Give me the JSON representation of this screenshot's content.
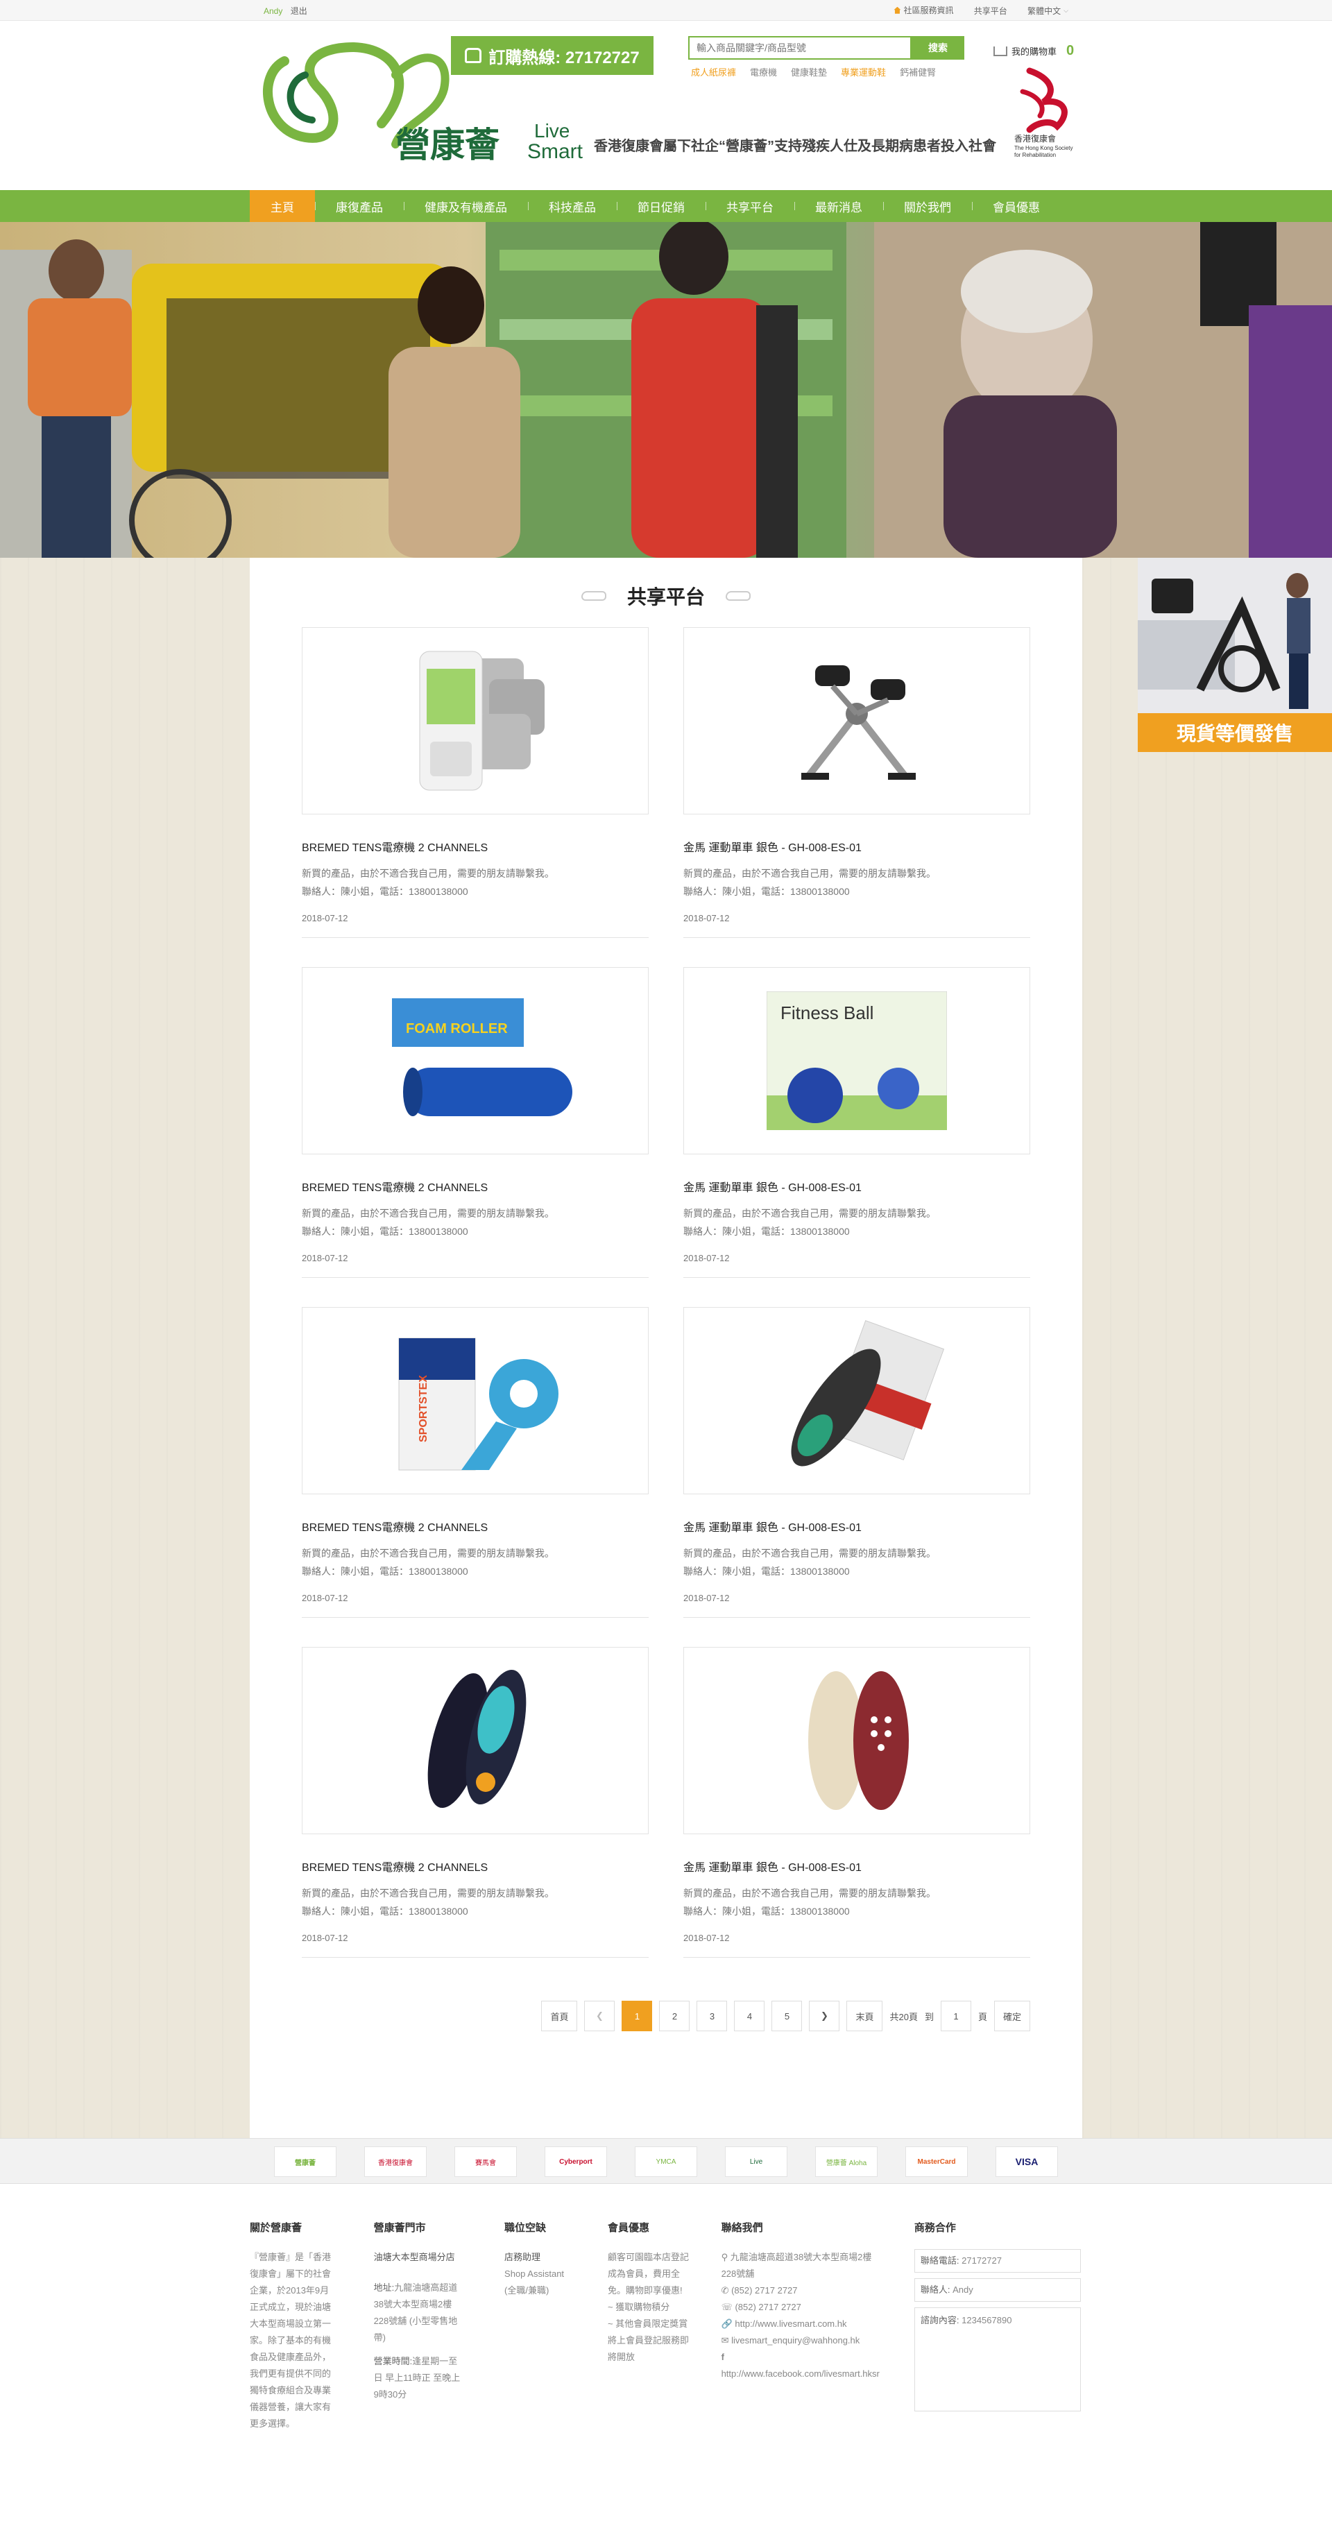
{
  "topbar": {
    "user": "Andy",
    "logout": "退出",
    "links": [
      "社區服務資訊",
      "共享平台",
      "繁體中文"
    ]
  },
  "header": {
    "hotline": "訂購熱線: 27172727",
    "search_placeholder": "輸入商品關鍵字/商品型號",
    "search_button": "搜索",
    "hotwords": [
      "成人紙尿褲",
      "電療機",
      "健康鞋墊",
      "專業運動鞋",
      "鈣補健腎"
    ],
    "slogan": "香港復康會屬下社企“營康薈”支持殘疾人仕及長期病患者投入社會",
    "cart_label": "我的購物車",
    "cart_count": "0",
    "logo_text": "營康薈",
    "logo_en1": "Live",
    "logo_en2": "Smart",
    "rehab_cn": "香港復康會",
    "rehab_en1": "The Hong Kong Society",
    "rehab_en2": "for Rehabilitation"
  },
  "nav": [
    "主頁",
    "康復產品",
    "健康及有機產品",
    "科技產品",
    "節日促銷",
    "共享平台",
    "最新消息",
    "關於我們",
    "會員優惠"
  ],
  "section_title": "共享平台",
  "promo": "現貨等價發售",
  "products": [
    {
      "name": "BREMED TENS電療機 2 CHANNELS",
      "desc": "新買的產品，由於不適合我自己用，需要的朋友請聯繫我。",
      "contact": "聯絡人：陳小姐，電話：13800138000",
      "date": "2018-07-12"
    },
    {
      "name": "金馬 運動單車 銀色 - GH-008-ES-01",
      "desc": "新買的產品，由於不適合我自己用，需要的朋友請聯繫我。",
      "contact": "聯絡人：陳小姐，電話：13800138000",
      "date": "2018-07-12"
    },
    {
      "name": "BREMED TENS電療機 2 CHANNELS",
      "desc": "新買的產品，由於不適合我自己用，需要的朋友請聯繫我。",
      "contact": "聯絡人：陳小姐，電話：13800138000",
      "date": "2018-07-12",
      "img_text": "FOAM ROLLER"
    },
    {
      "name": "金馬 運動單車 銀色 - GH-008-ES-01",
      "desc": "新買的產品，由於不適合我自己用，需要的朋友請聯繫我。",
      "contact": "聯絡人：陳小姐，電話：13800138000",
      "date": "2018-07-12",
      "img_text": "Fitness Ball"
    },
    {
      "name": "BREMED TENS電療機 2 CHANNELS",
      "desc": "新買的產品，由於不適合我自己用，需要的朋友請聯繫我。",
      "contact": "聯絡人：陳小姐，電話：13800138000",
      "date": "2018-07-12",
      "img_text": "SPORTSTEX"
    },
    {
      "name": "金馬 運動單車 銀色 - GH-008-ES-01",
      "desc": "新買的產品，由於不適合我自己用，需要的朋友請聯繫我。",
      "contact": "聯絡人：陳小姐，電話：13800138000",
      "date": "2018-07-12"
    },
    {
      "name": "BREMED TENS電療機 2 CHANNELS",
      "desc": "新買的產品，由於不適合我自己用，需要的朋友請聯繫我。",
      "contact": "聯絡人：陳小姐，電話：13800138000",
      "date": "2018-07-12"
    },
    {
      "name": "金馬 運動單車 銀色 - GH-008-ES-01",
      "desc": "新買的產品，由於不適合我自己用，需要的朋友請聯繫我。",
      "contact": "聯絡人：陳小姐，電話：13800138000",
      "date": "2018-07-12"
    }
  ],
  "pager": {
    "first": "首頁",
    "pages": [
      "1",
      "2",
      "3",
      "4",
      "5"
    ],
    "current": "1",
    "last": "末頁",
    "total": "共20頁",
    "goto": "到",
    "goto_value": "1",
    "page_unit": "頁",
    "confirm": "確定"
  },
  "partners": [
    "營康薈",
    "香港復康會",
    "賽馬會",
    "Cyberport",
    "YMCA",
    "Live",
    "營康薈 Aloha",
    "MasterCard",
    "VISA"
  ],
  "footer": {
    "about": {
      "title": "關於營康薈",
      "text": "『營康薈』是「香港復康會」屬下的社會企業，於2013年9月正式成立，現於油塘大本型商場設立第一家。除了基本的有機食品及健康產品外，我們更有提供不同的獨特食療組合及專業儀器營養，讓大家有更多選擇。"
    },
    "store": {
      "title": "營康薈門市",
      "name": "油塘大本型商場分店",
      "addr_label": "地址:",
      "addr": "九龍油塘高超道38號大本型商場2樓228號舖 (小型零售地帶)",
      "hours_label": "營業時間:",
      "hours": "逢星期一至日 早上11時正 至晚上 9時30分"
    },
    "jobs": {
      "title": "職位空缺",
      "items": [
        "店務助理",
        "Shop Assistant",
        "(全職/兼職)"
      ]
    },
    "member": {
      "title": "會員優惠",
      "text": "顧客可園臨本店登記成為會員，費用全免。購物即享優惠!",
      "items": [
        "~ 獲取購物積分",
        "~ 其他會員限定獎賞將上會員登記服務即將開放"
      ]
    },
    "contact": {
      "title": "聯絡我們",
      "address": "九龍油塘高超道38號大本型商場2樓228號舖",
      "tel": "(852) 2717  2727",
      "fax": "(852) 2717  2727",
      "web": "http://www.livesmart.com.hk",
      "email": "livesmart_enquiry@wahhong.hk",
      "facebook": "http://www.facebook.com/livesmart.hksr"
    },
    "biz": {
      "title": "商務合作",
      "phone_label": "聯絡電話:",
      "phone": "27172727",
      "person_label": "聯絡人:",
      "person": "Andy",
      "content_label": "諮詢內容:",
      "content": "1234567890"
    }
  },
  "colors": {
    "brand_green": "#7ab541",
    "accent_orange": "#f0a020"
  }
}
